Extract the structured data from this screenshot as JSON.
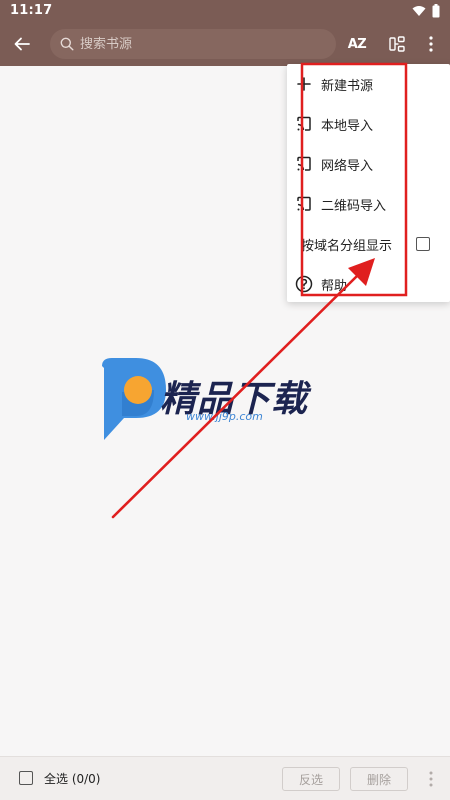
{
  "status_bar": {
    "time": "11:17",
    "icons": [
      "wifi-icon",
      "battery-icon"
    ]
  },
  "app_bar": {
    "search_placeholder": "搜索书源",
    "sort_label": "AZ",
    "actions": [
      "back-arrow-icon",
      "sort-az-icon",
      "group-icon",
      "more-vert-icon"
    ]
  },
  "menu": {
    "items": [
      {
        "label": "新建书源",
        "icon": "plus-icon"
      },
      {
        "label": "本地导入",
        "icon": "cast-icon"
      },
      {
        "label": "网络导入",
        "icon": "cast-icon"
      },
      {
        "label": "二维码导入",
        "icon": "cast-icon"
      },
      {
        "label": "按域名分组显示",
        "icon": "",
        "checkbox": false
      },
      {
        "label": "帮助",
        "icon": "help-icon"
      }
    ]
  },
  "watermark": {
    "text": "精品下载",
    "url": "www.jj9p.com"
  },
  "bottom_bar": {
    "select_all_label": "全选 (0/0)",
    "invert_label": "反选",
    "delete_label": "删除"
  },
  "colors": {
    "primary": "#7b5c55",
    "annotation": "#e01f1f",
    "background": "#f7f6f6"
  }
}
